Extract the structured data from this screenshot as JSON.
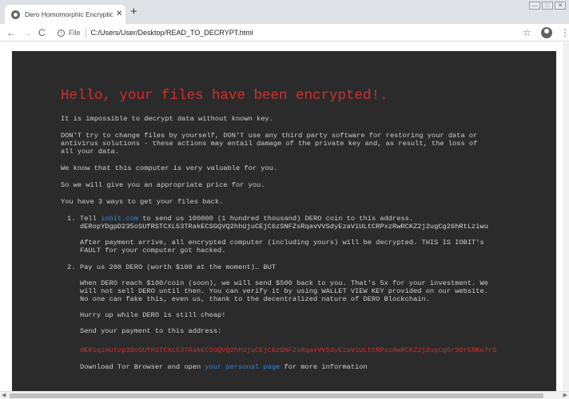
{
  "browser": {
    "tab_title": "Dero Homomorphic Encryption",
    "tab_close": "✕",
    "new_tab": "+",
    "scheme": "File",
    "url": "C:/Users/User/Desktop/READ_TO_DECRYPT.html",
    "icons": {
      "back": "←",
      "forward": "→",
      "reload": "C",
      "info": "i",
      "star": "☆",
      "menu": "⋮",
      "minimize": "—",
      "maximize": "□",
      "close": "✕",
      "scroll_left": "◀",
      "scroll_right": "▶"
    }
  },
  "note": {
    "headline": "Hello, your files have been encrypted!.",
    "line1": "It is impossible to decrypt data without known key.",
    "line2": "DON'T try to change files by yourself, DON'T use any third party software for restoring your data or\nantivirus solutions - these actions may entail damage of the private key and, as result, the loss of\nall your data.",
    "line3": "We know that this computer is very valuable for you.",
    "line4": "So we will give you an appropriate price for you.",
    "line5": "You have 3 ways to get your files back.",
    "item1": {
      "num": "1.",
      "prefix": "Tell ",
      "link": "iobit.com",
      "suffix": " to send us 100000 (1 hundred thousand) DERO coin to this address.",
      "address": "dERopYDgpD235oSUfRSTCXL53TRakECSGQVQ2hhUjuCEjC6zSNFZsRqavVVSdyEzaViULtCRPxzRwRCKZ2j2ugCg26hRtLziwu",
      "note": "After payment arrive, all encrypted computer (including yours) will be decrypted. THIS IS IOBIT's\nFAULT for your computer got hacked."
    },
    "item2": {
      "num": "2.",
      "title": "Pay us 200 DERO (worth $100 at the moment)… BUT",
      "para": "When DERO reach $100/coin (soon), we will send $500 back to you. That's 5x for your investment. We\nwill not sell DERO until then. You can verify it by using WALLET VIEW KEY provided on our website.\nNo one can fake this, even us, thank to the decentralized nature of DERO Blockchain.",
      "hurry": "Hurry up while DERO is still cheap!",
      "send": "Send your payment to this address:",
      "address": "dERiqiHutvp3SoSUfRSTCXL53TRakECSGQVQ2hhUjuCEjC6zSNFZsRqavVVSdyEzaViULtCRPxzRwRCKZ2j2ugCg5r9SrERKe7rS",
      "download_prefix": "Download Tor Browser and open ",
      "download_link": "your personal page",
      "download_suffix": " for more information"
    }
  }
}
